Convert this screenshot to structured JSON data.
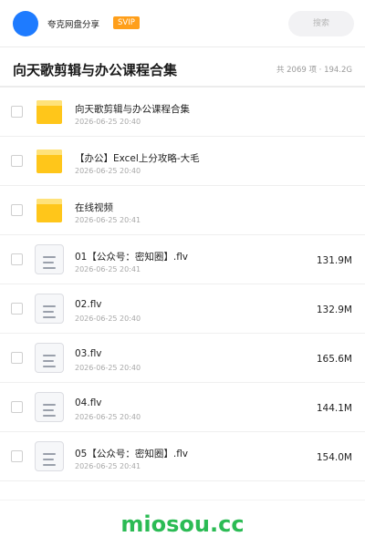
{
  "header": {
    "brand": "夸克网盘分享",
    "badge": "SVIP",
    "search_placeholder": "搜索"
  },
  "titlebar": {
    "title": "向天歌剪辑与办公课程合集",
    "summary": "共 2069 项 · 194.2G"
  },
  "files": [
    {
      "name": "向天歌剪辑与办公课程合集",
      "date": "2026-06-25 20:40",
      "size": "",
      "icon": "folder-icon"
    },
    {
      "name": "【办公】Excel上分攻略-大毛",
      "date": "2026-06-25 20:40",
      "size": "",
      "icon": "folder-icon"
    },
    {
      "name": "在线视频",
      "date": "2026-06-25 20:41",
      "size": "",
      "icon": "folder-icon"
    },
    {
      "name": "01【公众号：密知圈】.flv",
      "date": "2026-06-25 20:41",
      "size": "131.9M",
      "icon": "document-icon"
    },
    {
      "name": "02.flv",
      "date": "2026-06-25 20:40",
      "size": "132.9M",
      "icon": "document-icon"
    },
    {
      "name": "03.flv",
      "date": "2026-06-25 20:40",
      "size": "165.6M",
      "icon": "document-icon"
    },
    {
      "name": "04.flv",
      "date": "2026-06-25 20:40",
      "size": "144.1M",
      "icon": "document-icon"
    },
    {
      "name": "05【公众号：密知圈】.flv",
      "date": "2026-06-25 20:41",
      "size": "154.0M",
      "icon": "document-icon"
    }
  ],
  "footer": {
    "watermark": "miosou.cc"
  },
  "colors": {
    "accent": "#1e7bff",
    "badge": "#ff9f1a",
    "folder": "#ffc61a",
    "watermark": "#2bbb54"
  }
}
